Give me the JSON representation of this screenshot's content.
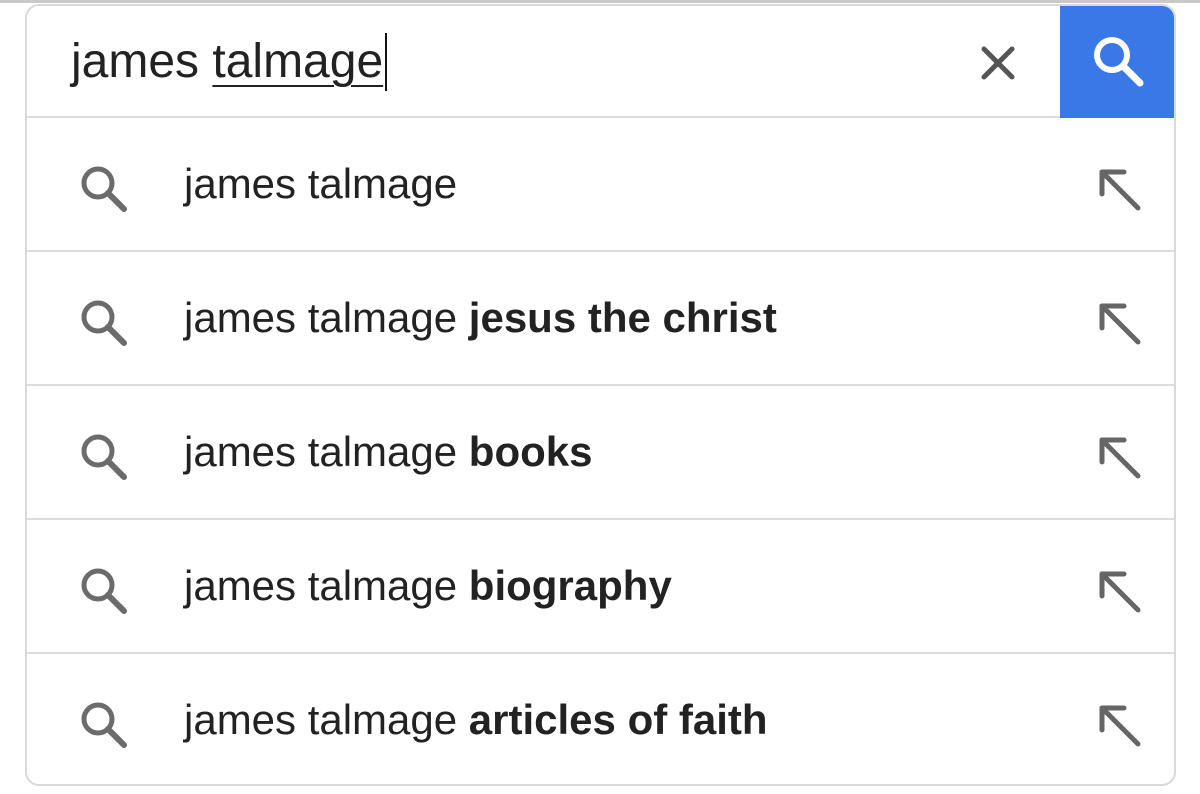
{
  "search": {
    "query_prefix": "james ",
    "query_underlined": "talmage"
  },
  "colors": {
    "search_button_bg": "#3b78e7"
  },
  "icons": {
    "clear": "close-icon",
    "submit": "search-icon",
    "suggestion": "search-icon",
    "fill": "arrow-up-left-icon"
  },
  "suggestions": [
    {
      "base": "james talmage",
      "completion": ""
    },
    {
      "base": "james talmage",
      "completion": "jesus the christ"
    },
    {
      "base": "james talmage",
      "completion": "books"
    },
    {
      "base": "james talmage",
      "completion": "biography"
    },
    {
      "base": "james talmage",
      "completion": "articles of faith"
    }
  ]
}
